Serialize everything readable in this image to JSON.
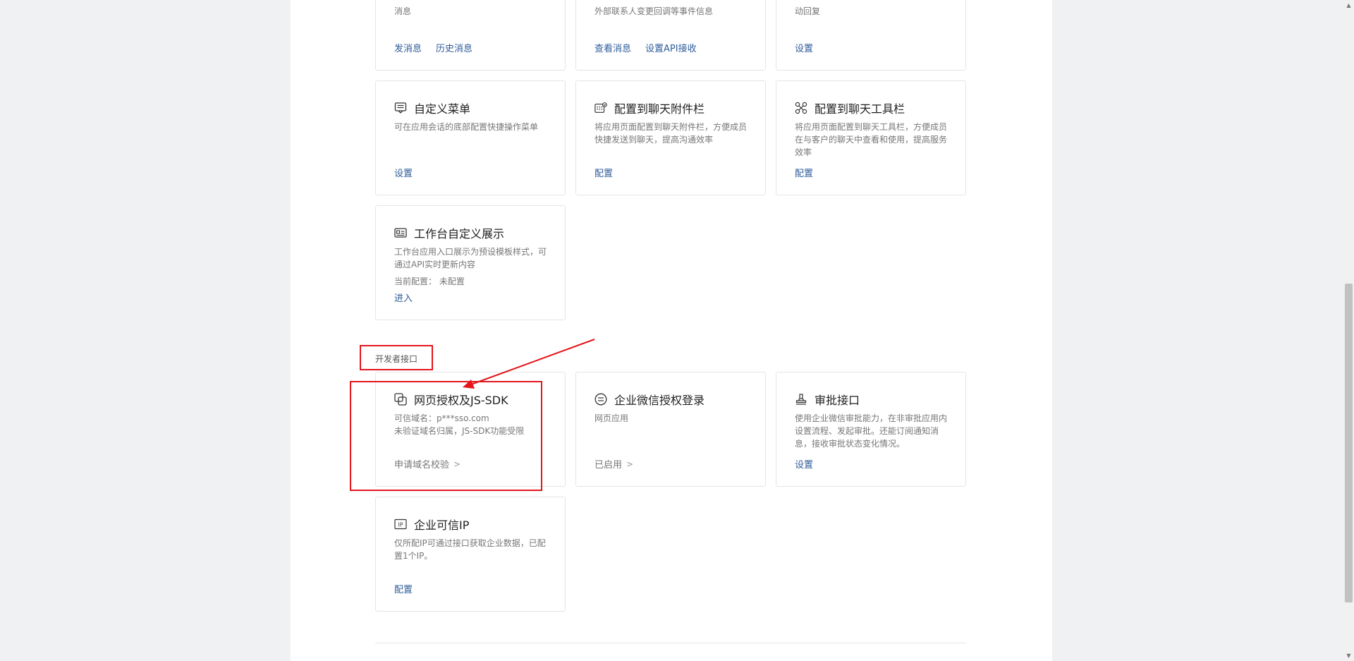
{
  "top_cards": [
    {
      "desc": "消息",
      "actions": [
        "发消息",
        "历史消息"
      ]
    },
    {
      "desc": "外部联系人变更回调等事件信息",
      "actions": [
        "查看消息",
        "设置API接收"
      ]
    },
    {
      "desc": "动回复",
      "actions": [
        "设置"
      ]
    }
  ],
  "feature_cards": [
    {
      "title": "自定义菜单",
      "icon": "menu-icon",
      "desc": "可在应用会话的底部配置快捷操作菜单",
      "action": "设置"
    },
    {
      "title": "配置到聊天附件栏",
      "icon": "attachment-grid-icon",
      "desc": "将应用页面配置到聊天附件栏，方便成员快捷发送到聊天，提高沟通效率",
      "action": "配置"
    },
    {
      "title": "配置到聊天工具栏",
      "icon": "toolbar-icon",
      "desc": "将应用页面配置到聊天工具栏，方便成员在与客户的聊天中查看和使用，提高服务效率",
      "action": "配置"
    },
    {
      "title": "工作台自定义展示",
      "icon": "workbench-card-icon",
      "desc": "工作台应用入口展示为预设模板样式，可通过API实时更新内容",
      "config_label": "当前配置：",
      "config_value": "未配置",
      "action": "进入"
    }
  ],
  "developer_section": {
    "label": "开发者接口"
  },
  "developer_cards": [
    {
      "title": "网页授权及JS-SDK",
      "icon": "web-auth-icon",
      "domain_label": "可信域名：",
      "domain_value": "p***sso.com",
      "desc2": "未验证域名归属，JS-SDK功能受限",
      "action": "申请域名校验"
    },
    {
      "title": "企业微信授权登录",
      "icon": "wecom-login-icon",
      "desc": "网页应用",
      "action": "已启用"
    },
    {
      "title": "审批接口",
      "icon": "stamp-icon",
      "desc": "使用企业微信审批能力，在非审批应用内设置流程、发起审批。还能订阅通知消息，接收审批状态变化情况。",
      "action": "设置"
    },
    {
      "title": "企业可信IP",
      "icon": "ip-icon",
      "desc": "仅所配IP可通过接口获取企业数据，已配置1个IP。",
      "action": "配置"
    }
  ],
  "colors": {
    "link": "#2f5c9a",
    "annotation": "#e4151c",
    "border": "#e3e5e8"
  }
}
